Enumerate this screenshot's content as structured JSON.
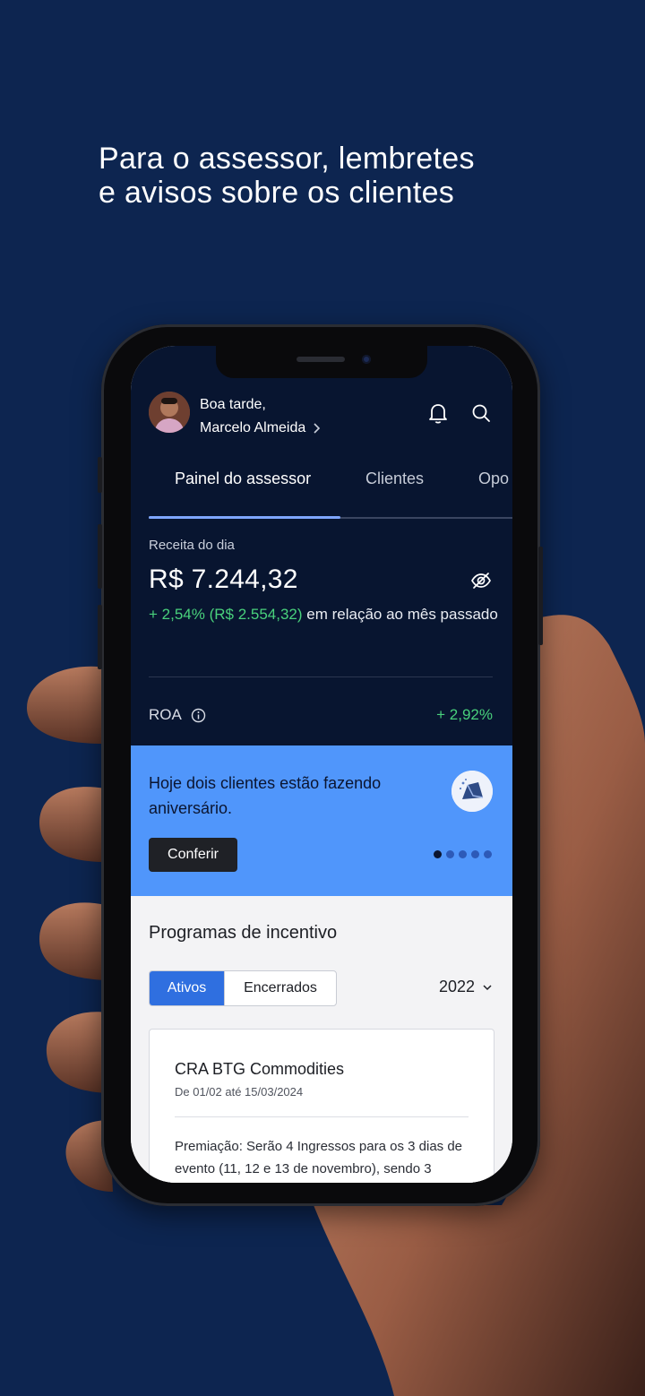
{
  "headline": {
    "line1": "Para o assessor, lembretes",
    "line2": "e avisos sobre os clientes"
  },
  "header": {
    "greeting": "Boa tarde,",
    "user_name": "Marcelo Almeida",
    "icons": [
      "bell-icon",
      "search-icon",
      "chevron-right-icon"
    ]
  },
  "tabs": [
    {
      "label": "Painel do assessor",
      "active": true
    },
    {
      "label": "Clientes",
      "active": false
    },
    {
      "label": "Opo",
      "active": false
    }
  ],
  "revenue": {
    "label": "Receita do dia",
    "value": "R$ 7.244,32",
    "change_positive": "+ 2,54% (R$ 2.554,32)",
    "change_suffix": " em relação ao mês passado",
    "icon": "eye-off-icon"
  },
  "roa": {
    "label": "ROA",
    "value": "+ 2,92%",
    "icon": "info-icon"
  },
  "banner": {
    "text": "Hoje dois clientes estão fazendo aniversário.",
    "button_label": "Conferir",
    "pagination_total": 5,
    "pagination_active": 1
  },
  "incentives": {
    "title": "Programas de incentivo",
    "segments": [
      "Ativos",
      "Encerrados"
    ],
    "selected_segment": "Ativos",
    "year": "2022",
    "card": {
      "title": "CRA BTG Commodities",
      "date": "De 01/02 até 15/03/2024",
      "body": "Premiação: Serão 4 Ingressos para os 3 dias de evento (11, 12 e 13 de novembro), sendo 3"
    }
  },
  "colors": {
    "background": "#0d2550",
    "dark_panel": "#081530",
    "banner": "#5096fb",
    "positive": "#49d17c",
    "accent": "#2f6fe0"
  }
}
